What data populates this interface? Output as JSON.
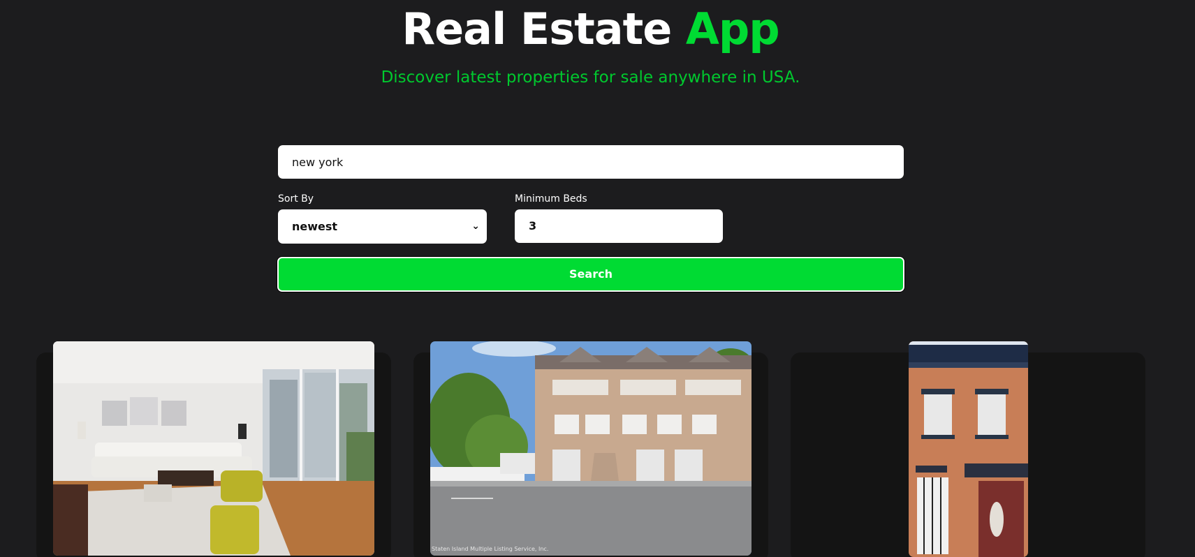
{
  "header": {
    "title_main": "Real Estate",
    "title_accent": "App",
    "subtitle": "Discover latest properties for sale anywhere in USA."
  },
  "search": {
    "value": "new york"
  },
  "filters": {
    "sort_label": "Sort By",
    "sort_value": "newest",
    "beds_label": "Minimum Beds",
    "beds_value": "3"
  },
  "search_button": {
    "label": "Search"
  },
  "colors": {
    "background": "#1c1c1e",
    "accent": "#00db33",
    "card": "#141414"
  },
  "listings": [
    {
      "image": "living-room-interior-photo"
    },
    {
      "image": "townhouse-exterior-photo",
      "watermark": "Staten Island Multiple Listing Service, Inc."
    },
    {
      "image": "brick-rowhouse-facade-photo"
    }
  ]
}
